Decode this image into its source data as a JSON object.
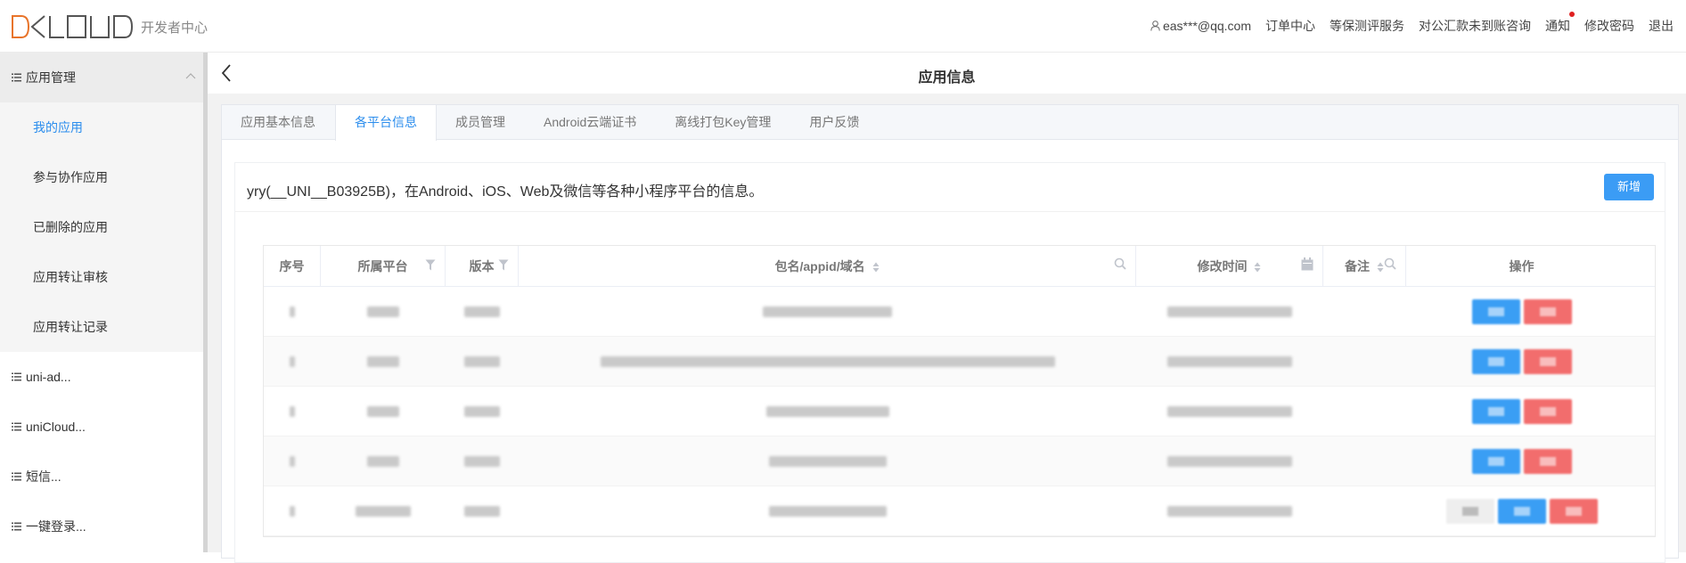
{
  "brand": {
    "logo_text": "DCLOUD",
    "subtitle": "开发者中心",
    "accent": "#e8742a"
  },
  "topnav": {
    "user": "eas***@qq.com",
    "orders": "订单中心",
    "security_eval": "等保测评服务",
    "payment_inquiry": "对公汇款未到账咨询",
    "notifications": "通知",
    "change_password": "修改密码",
    "logout": "退出"
  },
  "sidebar": {
    "groups": [
      {
        "label": "应用管理",
        "expanded": true,
        "items": [
          {
            "label": "我的应用",
            "active": true
          },
          {
            "label": "参与协作应用"
          },
          {
            "label": "已删除的应用"
          },
          {
            "label": "应用转让审核"
          },
          {
            "label": "应用转让记录"
          }
        ]
      },
      {
        "label": "uni-ad..."
      },
      {
        "label": "uniCloud..."
      },
      {
        "label": "短信..."
      },
      {
        "label": "一键登录..."
      }
    ]
  },
  "page": {
    "title": "应用信息"
  },
  "tabs": [
    {
      "label": "应用基本信息"
    },
    {
      "label": "各平台信息",
      "active": true
    },
    {
      "label": "成员管理"
    },
    {
      "label": "Android云端证书"
    },
    {
      "label": "离线打包Key管理"
    },
    {
      "label": "用户反馈"
    }
  ],
  "panel": {
    "title": "yry(__UNI__B03925B)，在Android、iOS、Web及微信等各种小程序平台的信息。",
    "add_button": "新增"
  },
  "table": {
    "columns": {
      "index": "序号",
      "platform": "所属平台",
      "version": "版本",
      "package": "包名/appid/域名",
      "modified": "修改时间",
      "remark": "备注",
      "actions": "操作"
    },
    "rows_note": "row contents are blurred/redacted",
    "row_count": 5
  },
  "colors": {
    "primary": "#3b9cf5",
    "danger": "#f26d6d",
    "active_text": "#2b8ded"
  }
}
